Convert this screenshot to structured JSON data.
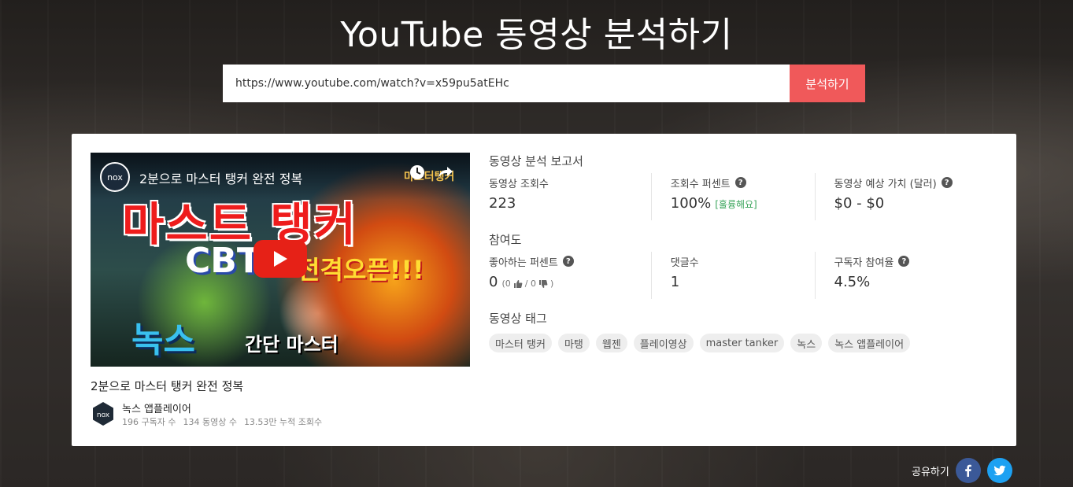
{
  "header": {
    "title": "YouTube 동영상 분석하기"
  },
  "search": {
    "value": "https://www.youtube.com/watch?v=x59pu5atEHc",
    "button_label": "분석하기"
  },
  "video": {
    "overlay_logo_text": "nox",
    "overlay_title": "2분으로 마스터 탱커 완전 정복",
    "thumb_headline": "마스트 탱커",
    "thumb_cbt": "CBT",
    "thumb_open": "전격오픈!!!",
    "thumb_nox": "녹스",
    "thumb_simple": "간단 마스터",
    "thumb_corner": "마스터탱커",
    "title": "2분으로 마스터 탱커 완전 정복",
    "channel": {
      "name": "녹스 앱플레이어",
      "avatar_text": "nox",
      "subscribers": "196 구독자 수",
      "video_count": "134 동영상 수",
      "total_views": "13.53만 누적 조회수"
    }
  },
  "report": {
    "title": "동영상 분석 보고서",
    "views_label": "동영상 조회수",
    "views_value": "223",
    "view_percent_label": "조회수 퍼센트",
    "view_percent_value": "100%",
    "view_percent_note": "[훌륭해요]",
    "est_value_label": "동영상 예상 가치 (달러)",
    "est_value_value": "$0 - $0"
  },
  "engagement": {
    "title": "참여도",
    "like_percent_label": "좋아하는 퍼센트",
    "like_percent_value": "0",
    "like_breakdown_open": "(0",
    "like_breakdown_mid": "/ 0",
    "like_breakdown_close": ")",
    "comments_label": "댓글수",
    "comments_value": "1",
    "sub_engagement_label": "구독자 참여율",
    "sub_engagement_value": "4.5%"
  },
  "tags": {
    "title": "동영상 태그",
    "items": [
      "마스터 탱커",
      "마탱",
      "웹젠",
      "플레이영상",
      "master tanker",
      "녹스",
      "녹스 앱플레이어"
    ]
  },
  "share": {
    "label": "공유하기"
  },
  "icons": {
    "help": "help-icon",
    "thumbs_up": "thumbs-up-icon",
    "thumbs_down": "thumbs-down-icon",
    "facebook": "facebook-icon",
    "twitter": "twitter-icon",
    "clock": "clock-icon",
    "share": "share-icon",
    "play": "play-icon"
  },
  "colors": {
    "accent": "#f0595a",
    "success": "#3ba55c",
    "facebook": "#3b5998",
    "twitter": "#1da1f2",
    "youtube_red": "#e62117"
  }
}
